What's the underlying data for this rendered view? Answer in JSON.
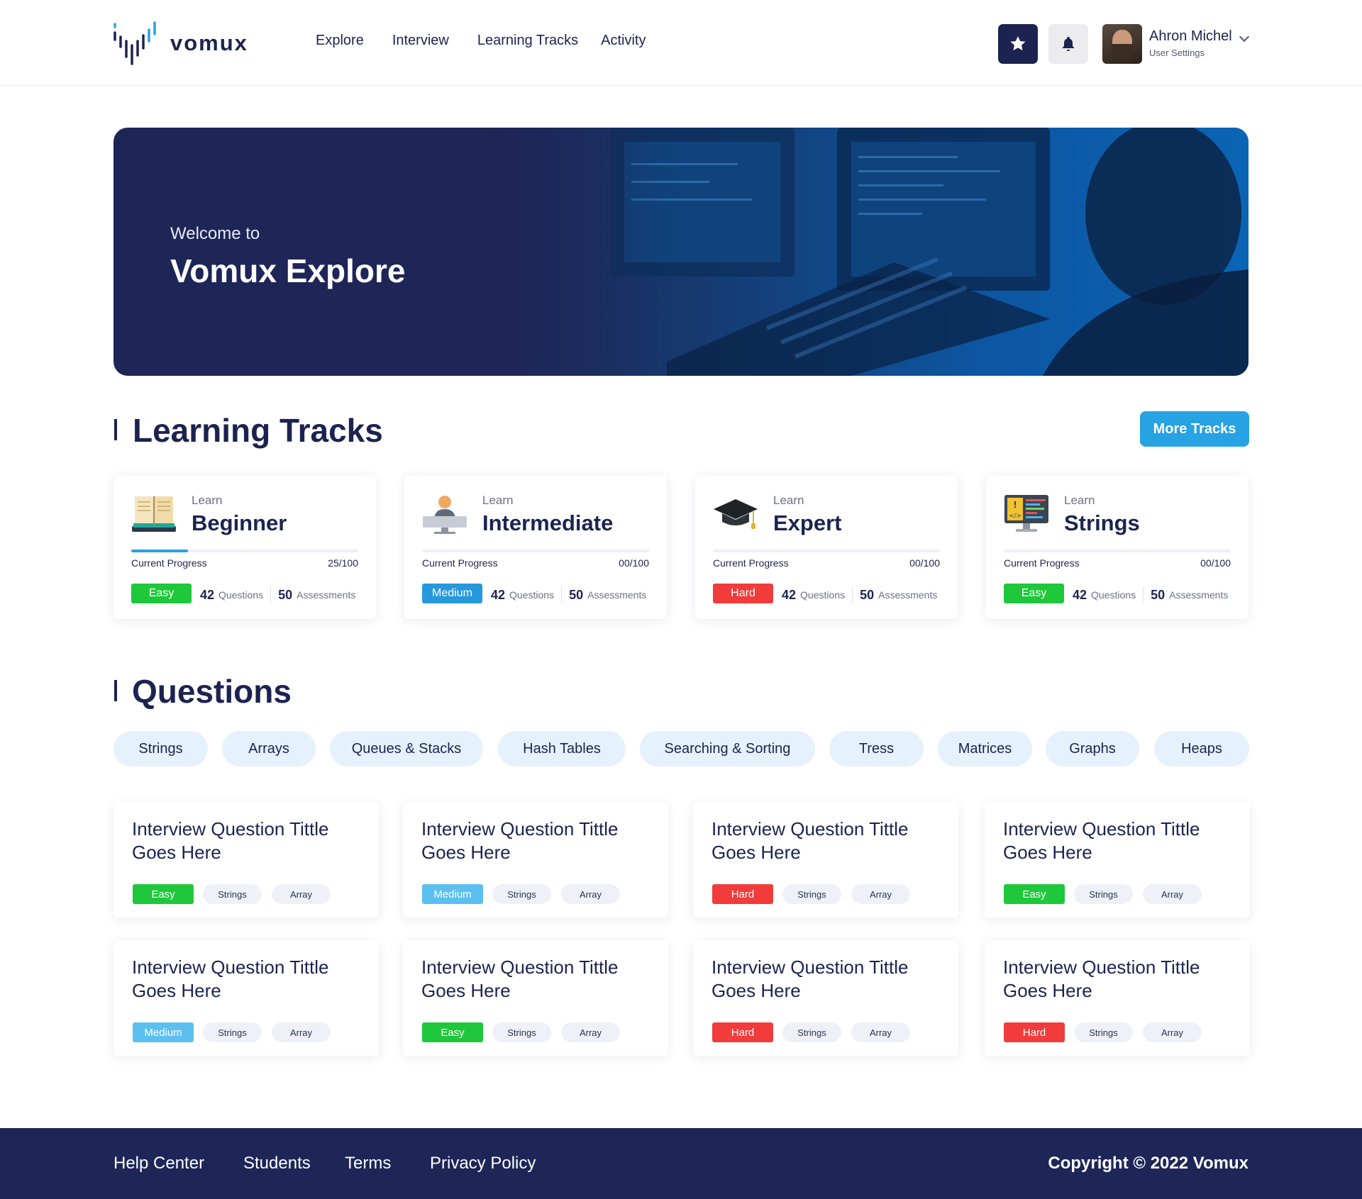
{
  "brand": {
    "name": "vomux",
    "logo_icon": "vomux-logo-icon"
  },
  "nav": {
    "items": [
      "Explore",
      "Interview",
      "Learning Tracks",
      "Activity"
    ]
  },
  "header": {
    "star_icon": "star-icon",
    "bell_icon": "bell-icon",
    "user": {
      "name": "Ahron Michel",
      "subtitle": "User Settings"
    }
  },
  "hero": {
    "small": "Welcome to",
    "title": "Vomux Explore"
  },
  "learning_tracks": {
    "title": "Learning Tracks",
    "more_label": "More Tracks",
    "progress_label": "Current Progress",
    "questions_label": "Questions",
    "assessments_label": "Assessments",
    "items": [
      {
        "learn": "Learn",
        "name": "Beginner",
        "icon": "book-icon",
        "progress": "25/100",
        "progress_fraction": 0.25,
        "difficulty": "Easy",
        "questions": "42",
        "assessments": "50"
      },
      {
        "learn": "Learn",
        "name": "Intermediate",
        "icon": "person-at-computer-icon",
        "progress": "00/100",
        "progress_fraction": 0,
        "difficulty": "Medium",
        "questions": "42",
        "assessments": "50"
      },
      {
        "learn": "Learn",
        "name": "Expert",
        "icon": "graduation-cap-icon",
        "progress": "00/100",
        "progress_fraction": 0,
        "difficulty": "Hard",
        "questions": "42",
        "assessments": "50"
      },
      {
        "learn": "Learn",
        "name": "Strings",
        "icon": "code-monitor-icon",
        "progress": "00/100",
        "progress_fraction": 0,
        "difficulty": "Easy",
        "questions": "42",
        "assessments": "50"
      }
    ]
  },
  "questions": {
    "title": "Questions",
    "filters": [
      "Strings",
      "Arrays",
      "Queues & Stacks",
      "Hash Tables",
      "Searching & Sorting",
      "Tress",
      "Matrices",
      "Graphs",
      "Heaps"
    ],
    "items": [
      {
        "title": "Interview Question Tittle Goes Here",
        "difficulty": "Easy",
        "tags": [
          "Strings",
          "Array"
        ]
      },
      {
        "title": "Interview Question Tittle Goes Here",
        "difficulty": "Medium",
        "tags": [
          "Strings",
          "Array"
        ]
      },
      {
        "title": "Interview Question Tittle Goes Here",
        "difficulty": "Hard",
        "tags": [
          "Strings",
          "Array"
        ]
      },
      {
        "title": "Interview Question Tittle Goes Here",
        "difficulty": "Easy",
        "tags": [
          "Strings",
          "Array"
        ]
      },
      {
        "title": "Interview Question Tittle Goes Here",
        "difficulty": "Medium",
        "tags": [
          "Strings",
          "Array"
        ]
      },
      {
        "title": "Interview Question Tittle Goes Here",
        "difficulty": "Easy",
        "tags": [
          "Strings",
          "Array"
        ]
      },
      {
        "title": "Interview Question Tittle Goes Here",
        "difficulty": "Hard",
        "tags": [
          "Strings",
          "Array"
        ]
      },
      {
        "title": "Interview Question Tittle Goes Here",
        "difficulty": "Hard",
        "tags": [
          "Strings",
          "Array"
        ]
      }
    ]
  },
  "footer": {
    "links": [
      "Help Center",
      "Students",
      "Terms",
      "Privacy Policy"
    ],
    "copyright": "Copyright © 2022 Vomux"
  },
  "colors": {
    "navy": "#1c2350",
    "accent": "#27a2e2",
    "easy": "#1ec83a",
    "medium_track": "#2699dd",
    "medium_question": "#5bc0f0",
    "hard": "#f23c3c",
    "chip_bg": "#e5f2fd"
  }
}
